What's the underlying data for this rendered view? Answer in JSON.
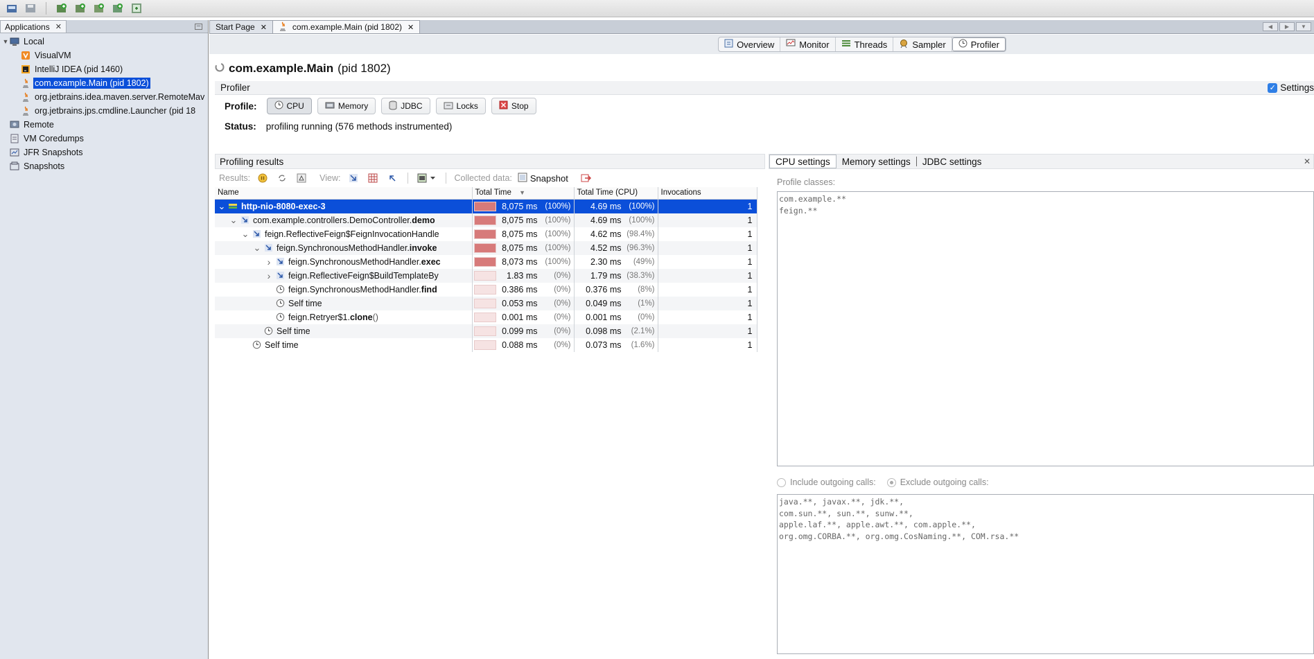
{
  "toolbar": {
    "buttons": [
      "open-application-icon",
      "save-icon",
      "add-jmx-connection-icon",
      "heap-dump-icon",
      "thread-dump-icon",
      "profiler-snapshot-icon",
      "application-snapshot-icon"
    ]
  },
  "left_panel": {
    "tab_label": "Applications",
    "tree": [
      {
        "label": "Local",
        "level": 0,
        "expanded": true,
        "icon": "computer-icon"
      },
      {
        "label": "VisualVM",
        "level": 1,
        "icon": "visualvm-icon"
      },
      {
        "label": "IntelliJ IDEA (pid 1460)",
        "level": 1,
        "icon": "intellij-icon"
      },
      {
        "label": "com.example.Main (pid 1802)",
        "level": 1,
        "icon": "java-icon",
        "selected": true
      },
      {
        "label": "org.jetbrains.idea.maven.server.RemoteMav",
        "level": 1,
        "icon": "java-icon"
      },
      {
        "label": "org.jetbrains.jps.cmdline.Launcher (pid 18",
        "level": 1,
        "icon": "java-icon"
      },
      {
        "label": "Remote",
        "level": 0,
        "icon": "remote-host-icon"
      },
      {
        "label": "VM Coredumps",
        "level": 0,
        "icon": "coredump-icon"
      },
      {
        "label": "JFR Snapshots",
        "level": 0,
        "icon": "jfr-icon"
      },
      {
        "label": "Snapshots",
        "level": 0,
        "icon": "snapshots-icon"
      }
    ]
  },
  "doc_tabs": [
    {
      "label": "Start Page",
      "active": false
    },
    {
      "label": "com.example.Main (pid 1802)",
      "active": true
    }
  ],
  "view_tabs": [
    {
      "label": "Overview",
      "icon": "overview-icon"
    },
    {
      "label": "Monitor",
      "icon": "monitor-icon"
    },
    {
      "label": "Threads",
      "icon": "threads-icon"
    },
    {
      "label": "Sampler",
      "icon": "sampler-icon"
    },
    {
      "label": "Profiler",
      "icon": "profiler-icon",
      "active": true
    }
  ],
  "page": {
    "title_bold": "com.example.Main",
    "title_pid": "(pid 1802)"
  },
  "profiler": {
    "header": "Profiler",
    "settings_label": "Settings",
    "profile_label": "Profile:",
    "buttons": [
      {
        "label": "CPU",
        "icon": "cpu-clock-icon",
        "pressed": true
      },
      {
        "label": "Memory",
        "icon": "memory-icon"
      },
      {
        "label": "JDBC",
        "icon": "jdbc-icon"
      },
      {
        "label": "Locks",
        "icon": "locks-icon"
      },
      {
        "label": "Stop",
        "icon": "stop-icon"
      }
    ],
    "status_label": "Status:",
    "status_value": "profiling running (576 methods instrumented)"
  },
  "results": {
    "header": "Profiling results",
    "results_label": "Results:",
    "view_label": "View:",
    "collected_label": "Collected data:",
    "snapshot_label": "Snapshot",
    "columns": [
      "Name",
      "Total Time",
      "Total Time (CPU)",
      "Invocations"
    ],
    "rows": [
      {
        "depth": 0,
        "toggle": "v",
        "icon": "thread",
        "name": "http-nio-8080-exec-3",
        "bold_part": "",
        "suffix": "",
        "total": "8,075 ms",
        "total_pct": "(100%)",
        "total_frac": 1.0,
        "cpu": "4.69 ms",
        "cpu_pct": "(100%)",
        "inv": "1",
        "selected": true
      },
      {
        "depth": 1,
        "toggle": "v",
        "icon": "method",
        "name": "com.example.controllers.DemoController.",
        "bold_part": "demo",
        "suffix": "",
        "total": "8,075 ms",
        "total_pct": "(100%)",
        "total_frac": 1.0,
        "cpu": "4.69 ms",
        "cpu_pct": "(100%)",
        "inv": "1"
      },
      {
        "depth": 2,
        "toggle": "v",
        "icon": "method",
        "name": "feign.ReflectiveFeign$FeignInvocationHandle",
        "bold_part": "",
        "suffix": "",
        "total": "8,075 ms",
        "total_pct": "(100%)",
        "total_frac": 1.0,
        "cpu": "4.62 ms",
        "cpu_pct": "(98.4%)",
        "inv": "1"
      },
      {
        "depth": 3,
        "toggle": "v",
        "icon": "method",
        "name": "feign.SynchronousMethodHandler.",
        "bold_part": "invoke",
        "suffix": "",
        "total": "8,075 ms",
        "total_pct": "(100%)",
        "total_frac": 1.0,
        "cpu": "4.52 ms",
        "cpu_pct": "(96.3%)",
        "inv": "1"
      },
      {
        "depth": 4,
        "toggle": ">",
        "icon": "method",
        "name": "feign.SynchronousMethodHandler.",
        "bold_part": "exec",
        "suffix": "",
        "total": "8,073 ms",
        "total_pct": "(100%)",
        "total_frac": 1.0,
        "cpu": "2.30 ms",
        "cpu_pct": "(49%)",
        "inv": "1"
      },
      {
        "depth": 4,
        "toggle": ">",
        "icon": "method",
        "name": "feign.ReflectiveFeign$BuildTemplateBy",
        "bold_part": "",
        "suffix": "",
        "total": "1.83 ms",
        "total_pct": "(0%)",
        "total_frac": 0.0,
        "cpu": "1.79 ms",
        "cpu_pct": "(38.3%)",
        "inv": "1"
      },
      {
        "depth": 4,
        "toggle": "",
        "icon": "clock",
        "name": "feign.SynchronousMethodHandler.",
        "bold_part": "find",
        "suffix": "",
        "total": "0.386 ms",
        "total_pct": "(0%)",
        "total_frac": 0.0,
        "cpu": "0.376 ms",
        "cpu_pct": "(8%)",
        "inv": "1"
      },
      {
        "depth": 4,
        "toggle": "",
        "icon": "clock",
        "name": "Self time",
        "bold_part": "",
        "suffix": "",
        "total": "0.053 ms",
        "total_pct": "(0%)",
        "total_frac": 0.0,
        "cpu": "0.049 ms",
        "cpu_pct": "(1%)",
        "inv": "1"
      },
      {
        "depth": 4,
        "toggle": "",
        "icon": "clock",
        "name": "feign.Retryer$1.",
        "bold_part": "clone",
        "suffix": " ()",
        "total": "0.001 ms",
        "total_pct": "(0%)",
        "total_frac": 0.0,
        "cpu": "0.001 ms",
        "cpu_pct": "(0%)",
        "inv": "1"
      },
      {
        "depth": 3,
        "toggle": "",
        "icon": "clock",
        "name": "Self time",
        "bold_part": "",
        "suffix": "",
        "total": "0.099 ms",
        "total_pct": "(0%)",
        "total_frac": 0.0,
        "cpu": "0.098 ms",
        "cpu_pct": "(2.1%)",
        "inv": "1"
      },
      {
        "depth": 2,
        "toggle": "",
        "icon": "clock",
        "name": "Self time",
        "bold_part": "",
        "suffix": "",
        "total": "0.088 ms",
        "total_pct": "(0%)",
        "total_frac": 0.0,
        "cpu": "0.073 ms",
        "cpu_pct": "(1.6%)",
        "inv": "1"
      }
    ]
  },
  "settings_panel": {
    "tabs": [
      "CPU settings",
      "Memory settings",
      "JDBC settings"
    ],
    "profile_classes_label": "Profile classes:",
    "profile_classes": "com.example.**\nfeign.**",
    "include_label": "Include outgoing calls:",
    "exclude_label": "Exclude outgoing calls:",
    "excluded_classes": "java.**, javax.**, jdk.**,\ncom.sun.**, sun.**, sunw.**,\napple.laf.**, apple.awt.**, com.apple.**,\norg.omg.CORBA.**, org.omg.CosNaming.**, COM.rsa.**"
  },
  "colors": {
    "selection": "#0b4fd9",
    "bar_fill": "#d77a7a",
    "bar_empty": "#f6e3e3"
  }
}
